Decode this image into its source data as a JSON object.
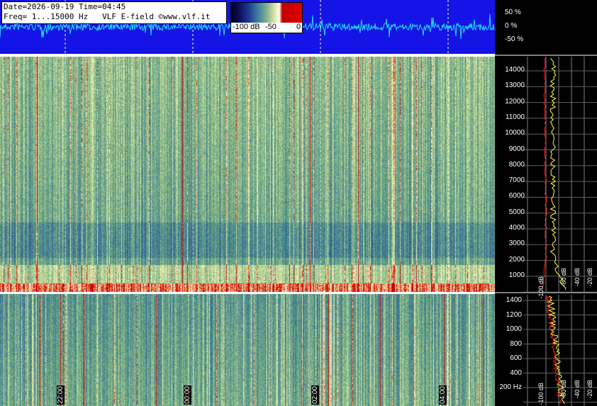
{
  "info": {
    "line1": "Date=2026-09-19 Time=04:45",
    "line2": "Freq= 1...15000 Hz   VLF E-field ©www.vlf.it"
  },
  "colorbar": {
    "labels": [
      "-100 dB",
      "-50",
      "0"
    ]
  },
  "waveform_scale": [
    "50 %",
    "0 %",
    "-50 %"
  ],
  "freq_axis_high": [
    "14000",
    "13000",
    "12000",
    "11000",
    "10000",
    "9000",
    "8000",
    "7000",
    "6000",
    "5000",
    "4000",
    "3000",
    "2000",
    "1000"
  ],
  "freq_axis_low": [
    "1400",
    "1200",
    "1000",
    "800",
    "600",
    "400",
    "200 Hz"
  ],
  "time_marks": [
    "22:00",
    "00:00",
    "02:00",
    "04:00"
  ],
  "db_labels_high": [
    "-100 dB",
    "-80 dB",
    "-40 dB",
    "-20 dB"
  ],
  "db_labels_low": [
    "-100 dB",
    "-80 dB",
    "-40 dB",
    "-20 dB"
  ],
  "colors": {
    "waveform_bg": "#1414e6",
    "trace_cyan": "#20e0ff",
    "spec_avg_yellow": "#ffff40",
    "spec_peak_red": "#ff2020"
  }
}
